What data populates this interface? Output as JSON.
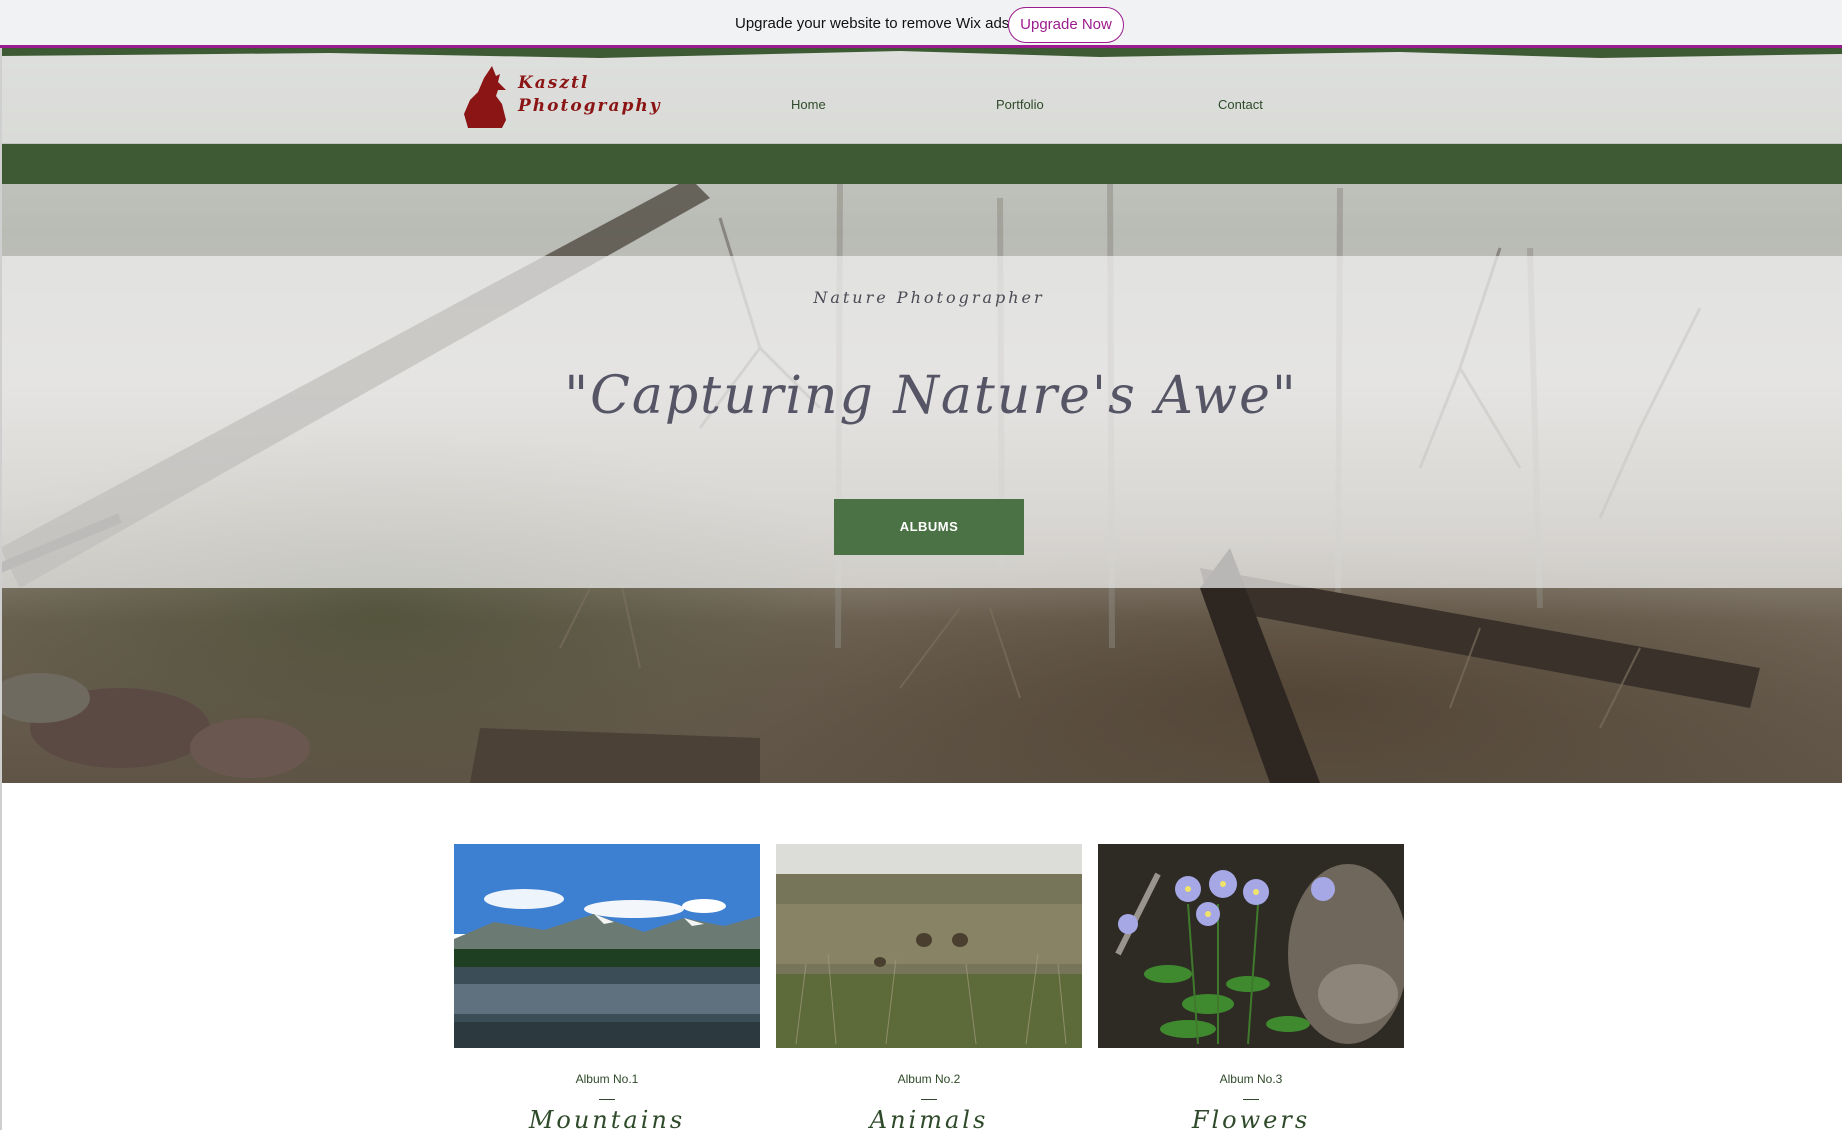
{
  "ad_bar": {
    "message": "Upgrade your website to remove Wix ads",
    "upgrade_label": "Upgrade Now"
  },
  "header": {
    "logo_line1": "Kasztl",
    "logo_line2": "Photography",
    "nav": [
      {
        "label": "Home"
      },
      {
        "label": "Portfolio"
      },
      {
        "label": "Contact"
      }
    ]
  },
  "hero": {
    "subtitle": "Nature Photographer",
    "headline": "\"Capturing Nature's Awe\"",
    "button_label": "ALBUMS"
  },
  "albums": [
    {
      "number": "Album No.1",
      "name": "Mountains"
    },
    {
      "number": "Album No.2",
      "name": "Animals"
    },
    {
      "number": "Album No.3",
      "name": "Flowers"
    }
  ],
  "colors": {
    "accent_green": "#3e5a34",
    "button_green": "#4a7245",
    "logo_red": "#8b1414",
    "wix_purple": "#9b1c8e"
  },
  "icons": {
    "logo": "howling-wolf-icon"
  }
}
